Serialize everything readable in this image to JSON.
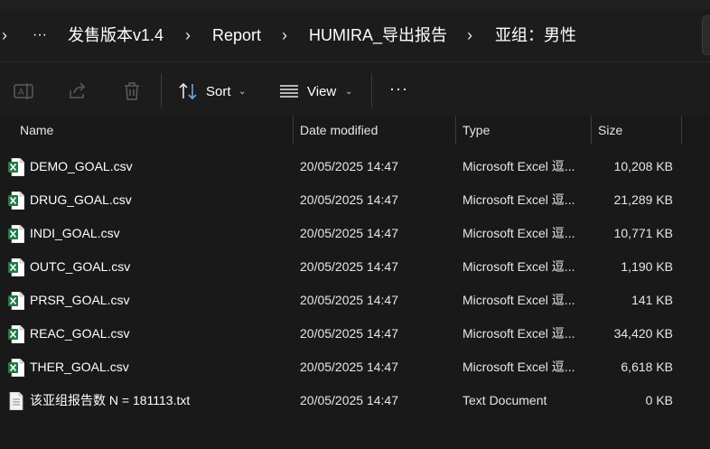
{
  "breadcrumb": {
    "overflow": "···",
    "items": [
      "发售版本v1.4",
      "Report",
      "HUMIRA_导出报告",
      "亚组：男性"
    ]
  },
  "toolbar": {
    "sort_label": "Sort",
    "view_label": "View",
    "more_label": "···"
  },
  "columns": {
    "name": "Name",
    "date": "Date modified",
    "type": "Type",
    "size": "Size"
  },
  "files": [
    {
      "name": "DEMO_GOAL.csv",
      "date": "20/05/2025 14:47",
      "type": "Microsoft Excel 逗...",
      "size": "10,208 KB",
      "icon": "excel-csv-icon"
    },
    {
      "name": "DRUG_GOAL.csv",
      "date": "20/05/2025 14:47",
      "type": "Microsoft Excel 逗...",
      "size": "21,289 KB",
      "icon": "excel-csv-icon"
    },
    {
      "name": "INDI_GOAL.csv",
      "date": "20/05/2025 14:47",
      "type": "Microsoft Excel 逗...",
      "size": "10,771 KB",
      "icon": "excel-csv-icon"
    },
    {
      "name": "OUTC_GOAL.csv",
      "date": "20/05/2025 14:47",
      "type": "Microsoft Excel 逗...",
      "size": "1,190 KB",
      "icon": "excel-csv-icon"
    },
    {
      "name": "PRSR_GOAL.csv",
      "date": "20/05/2025 14:47",
      "type": "Microsoft Excel 逗...",
      "size": "141 KB",
      "icon": "excel-csv-icon"
    },
    {
      "name": "REAC_GOAL.csv",
      "date": "20/05/2025 14:47",
      "type": "Microsoft Excel 逗...",
      "size": "34,420 KB",
      "icon": "excel-csv-icon"
    },
    {
      "name": "THER_GOAL.csv",
      "date": "20/05/2025 14:47",
      "type": "Microsoft Excel 逗...",
      "size": "6,618 KB",
      "icon": "excel-csv-icon"
    },
    {
      "name": "该亚组报告数 N = 181113.txt",
      "date": "20/05/2025 14:47",
      "type": "Text Document",
      "size": "0 KB",
      "icon": "text-file-icon"
    }
  ],
  "colors": {
    "background": "#191919",
    "excel_green": "#1f7a45",
    "text": "#ffffff"
  }
}
